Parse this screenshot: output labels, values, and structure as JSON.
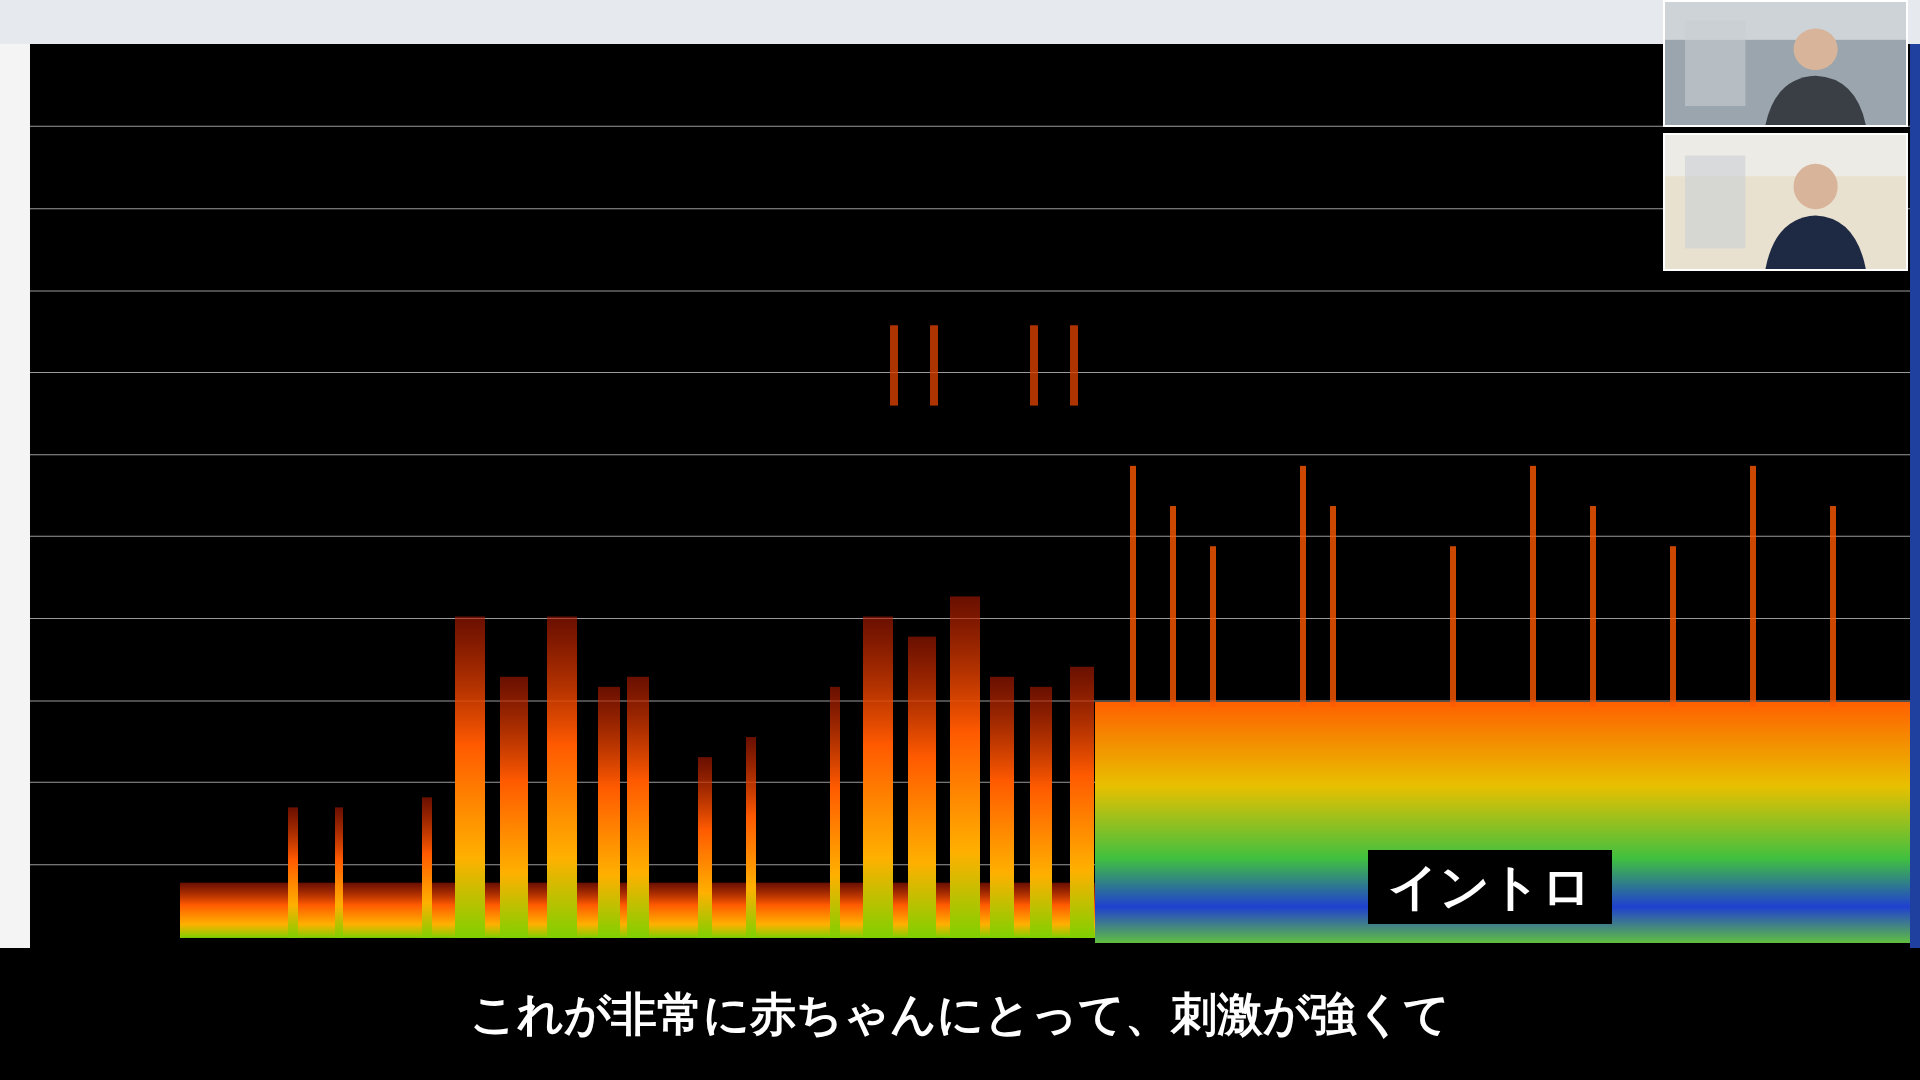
{
  "spectrogram_label": "イントロ",
  "caption": "これが非常に赤ちゃんにとって、刺激が強くて"
}
